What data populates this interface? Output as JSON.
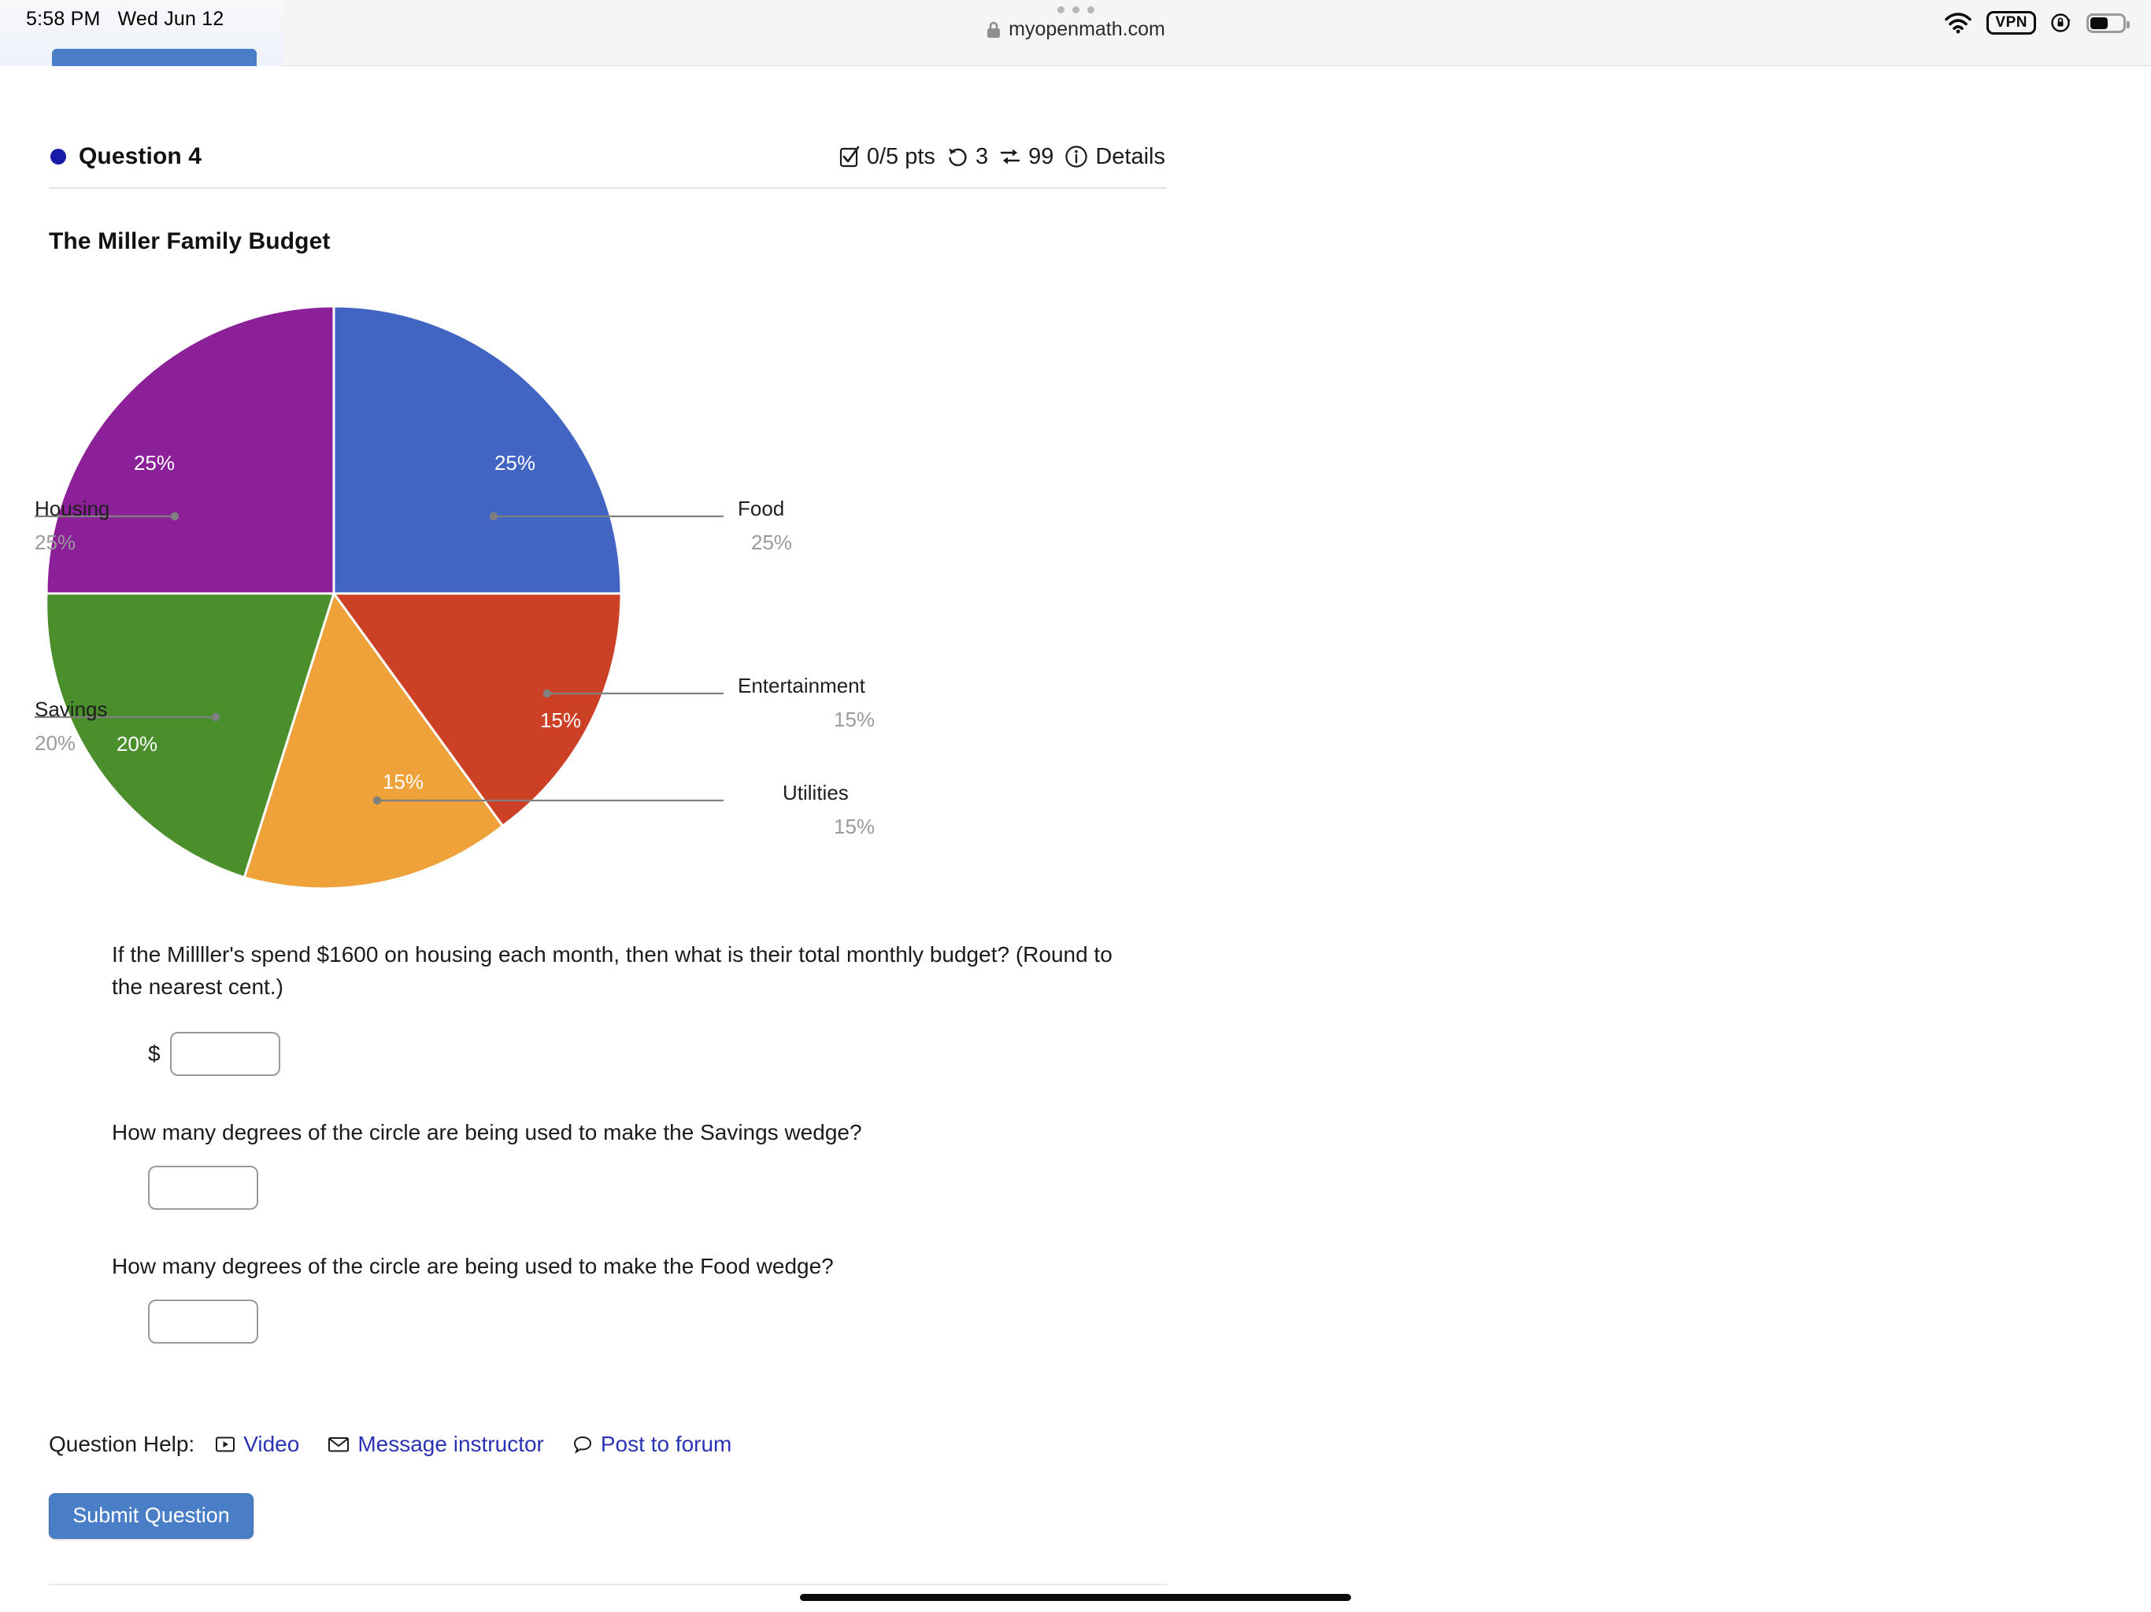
{
  "statusbar": {
    "time": "5:58 PM",
    "date": "Wed Jun 12",
    "wifi_icon": "wifi-icon",
    "vpn_label": "VPN",
    "rotation_lock_icon": "rotation-lock-icon",
    "battery_icon": "battery-icon"
  },
  "browser": {
    "url": "myopenmath.com",
    "lock_icon": "lock-icon",
    "menu_icon": "three-dots-icon"
  },
  "question_header": {
    "status_dot_color": "#1a1aa8",
    "title": "Question 4",
    "points": "0/5 pts",
    "attempts": "3",
    "versions": "99",
    "details_label": "Details",
    "checkbox_icon": "checkbox-icon",
    "undo_icon": "undo-icon",
    "shuffle_icon": "shuffle-icon",
    "info_icon": "info-icon"
  },
  "chart_data": {
    "type": "pie",
    "title": "The Miller Family Budget",
    "categories": [
      "Food",
      "Entertainment",
      "Utilities",
      "Savings",
      "Housing"
    ],
    "values": [
      25,
      15,
      15,
      20,
      25
    ],
    "value_labels": [
      "25%",
      "15%",
      "15%",
      "20%",
      "25%"
    ],
    "colors": [
      "#4265c4",
      "#cc4125",
      "#efa13a",
      "#4a8f2c",
      "#8b2098"
    ],
    "slices": [
      {
        "label": "Food",
        "value": 25,
        "value_label": "25%",
        "color": "#4265c4"
      },
      {
        "label": "Entertainment",
        "value": 15,
        "value_label": "15%",
        "color": "#cc4125"
      },
      {
        "label": "Utilities",
        "value": 15,
        "value_label": "15%",
        "color": "#efa13a"
      },
      {
        "label": "Savings",
        "value": 20,
        "value_label": "20%",
        "color": "#4a8f2c"
      },
      {
        "label": "Housing",
        "value": 25,
        "value_label": "25%",
        "color": "#8b2098"
      }
    ],
    "legend_position": "callout-labels",
    "start_angle": 0,
    "direction": "clockwise"
  },
  "question": {
    "prompt": "If the Millller's spend $1600 on housing each month, then what is their total monthly budget? (Round to the nearest cent.)",
    "currency_symbol": "$",
    "answer1_value": "",
    "answer1_placeholder": "",
    "sub_prompt_1": "How many degrees of the circle are being used to make the Savings wedge?",
    "answer2_value": "",
    "answer2_placeholder": "",
    "sub_prompt_2": "How many degrees of the circle are being used to make the Food wedge?",
    "answer3_value": "",
    "answer3_placeholder": ""
  },
  "help": {
    "label": "Question Help:",
    "video": "Video",
    "message_instructor": "Message instructor",
    "post_to_forum": "Post to forum",
    "video_icon": "play-video-icon",
    "mail_icon": "envelope-icon",
    "forum_icon": "speech-bubble-icon"
  },
  "actions": {
    "submit_label": "Submit Question"
  }
}
